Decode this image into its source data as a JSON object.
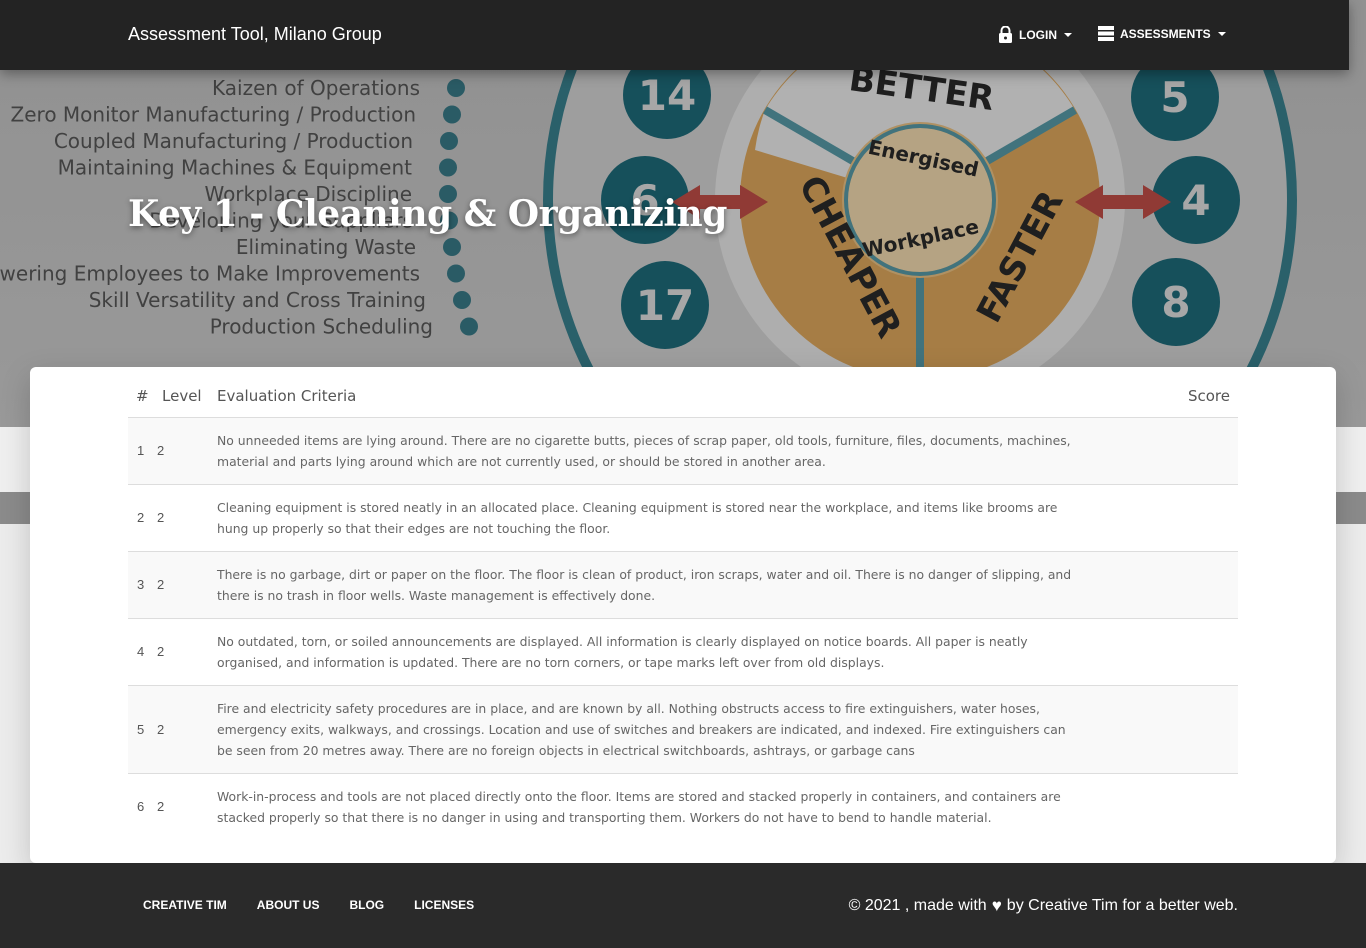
{
  "navbar": {
    "brand": "Assessment Tool,  Milano Group",
    "login_label": "LOGIN",
    "assessments_label": "ASSESSMENTS"
  },
  "hero": {
    "title": "Key 1 - Cleaning & Organizing",
    "background_list": [
      "Kaizen of Operations",
      "Zero Monitor Manufacturing / Production",
      "Coupled Manufacturing / Production",
      "Maintaining Machines & Equipment",
      "Workplace Discipline",
      "Developing your Suppliers",
      "Eliminating Waste",
      "Empowering Employees to Make Improvements",
      "Skill Versatility and Cross Training",
      "Production Scheduling"
    ],
    "background_wheel": {
      "center": [
        "Energised",
        "Workplace"
      ],
      "segments": [
        "BETTER",
        "CHEAPER",
        "FASTER"
      ],
      "numbers": [
        "14",
        "6",
        "17",
        "5",
        "4",
        "8"
      ]
    }
  },
  "table": {
    "headers": {
      "num": "#",
      "level": "Level",
      "criteria": "Evaluation Criteria",
      "score": "Score"
    },
    "rows": [
      {
        "num": "1",
        "level": "2",
        "text": "No unneeded items are lying around. There are no cigarette butts, pieces of scrap paper, old tools, furniture, files, documents, machines, material and parts lying around which are not currently used, or should be stored in another area.",
        "score": ""
      },
      {
        "num": "2",
        "level": "2",
        "text": "Cleaning equipment is stored neatly in an allocated place. Cleaning equipment is stored near the workplace, and items like brooms are hung up properly so that their edges are not touching the floor.",
        "score": ""
      },
      {
        "num": "3",
        "level": "2",
        "text": "There is no garbage, dirt or paper on the floor. The floor is clean of product, iron scraps, water and oil. There is no danger of slipping, and there is no trash in floor wells. Waste management is effectively done.",
        "score": ""
      },
      {
        "num": "4",
        "level": "2",
        "text": "No outdated, torn, or soiled announcements are displayed. All information is clearly displayed on notice boards. All paper is neatly organised, and information is updated. There are no torn corners, or tape marks left over from old displays.",
        "score": ""
      },
      {
        "num": "5",
        "level": "2",
        "text": "Fire and electricity safety procedures are in place, and are known by all. Nothing obstructs access to fire extinguishers, water hoses, emergency exits, walkways, and crossings. Location and use of switches and breakers are indicated, and indexed. Fire extinguishers can be seen from 20 metres away. There are no foreign objects in electrical switchboards, ashtrays, or garbage cans",
        "score": ""
      },
      {
        "num": "6",
        "level": "2",
        "text": "Work-in-process and tools are not placed directly onto the floor. Items are stored and stacked properly in containers, and containers are stacked properly so that there is no danger in using and transporting them. Workers do not have to bend to handle material.",
        "score": ""
      }
    ]
  },
  "footer": {
    "links": [
      "CREATIVE TIM",
      "ABOUT US",
      "BLOG",
      "LICENSES"
    ],
    "copyright_prefix": "© 2021 , made with",
    "heart_icon": "heart-icon",
    "copyright_suffix": "by Creative Tim for a better web."
  },
  "colors": {
    "navbar": "#232323",
    "footer": "#2a2a2a",
    "wheel_teal": "#2e7f8f",
    "wheel_orange": "#e0962c"
  }
}
